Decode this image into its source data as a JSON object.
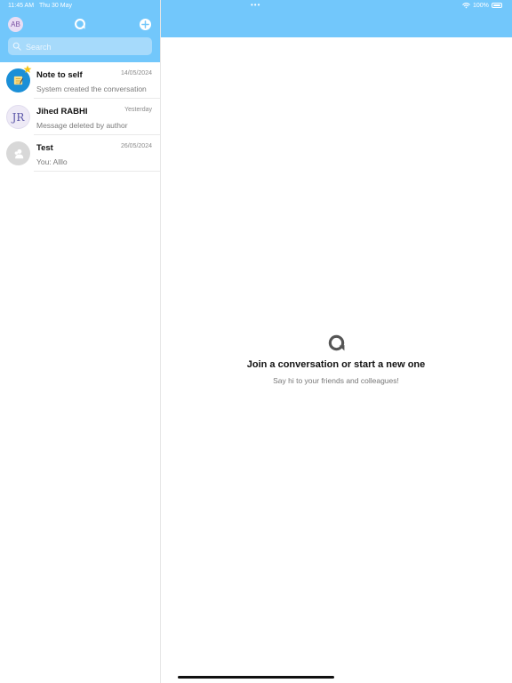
{
  "status_bar": {
    "time": "11:45 AM",
    "date": "Thu 30 May",
    "battery": "100%"
  },
  "sidebar": {
    "user_initials": "AB",
    "search": {
      "placeholder": "Search",
      "value": ""
    },
    "conversations": [
      {
        "name": "Note to self",
        "date": "14/05/2024",
        "preview": "System created the conversation",
        "avatar": "note-icon",
        "favorite": true
      },
      {
        "name": "Jihed RABHI",
        "date": "Yesterday",
        "preview": "Message deleted by author",
        "avatar_initials": "JR"
      },
      {
        "name": "Test",
        "date": "26/05/2024",
        "preview": "You: Alllo",
        "avatar": "group-icon"
      }
    ]
  },
  "main": {
    "title": "Join a conversation or start a new one",
    "subtitle": "Say hi to your friends and colleagues!"
  },
  "colors": {
    "header": "#72c7fb",
    "search_bg": "#a6dafb",
    "note_avatar": "#1b8fd7",
    "star": "#f5c518"
  }
}
